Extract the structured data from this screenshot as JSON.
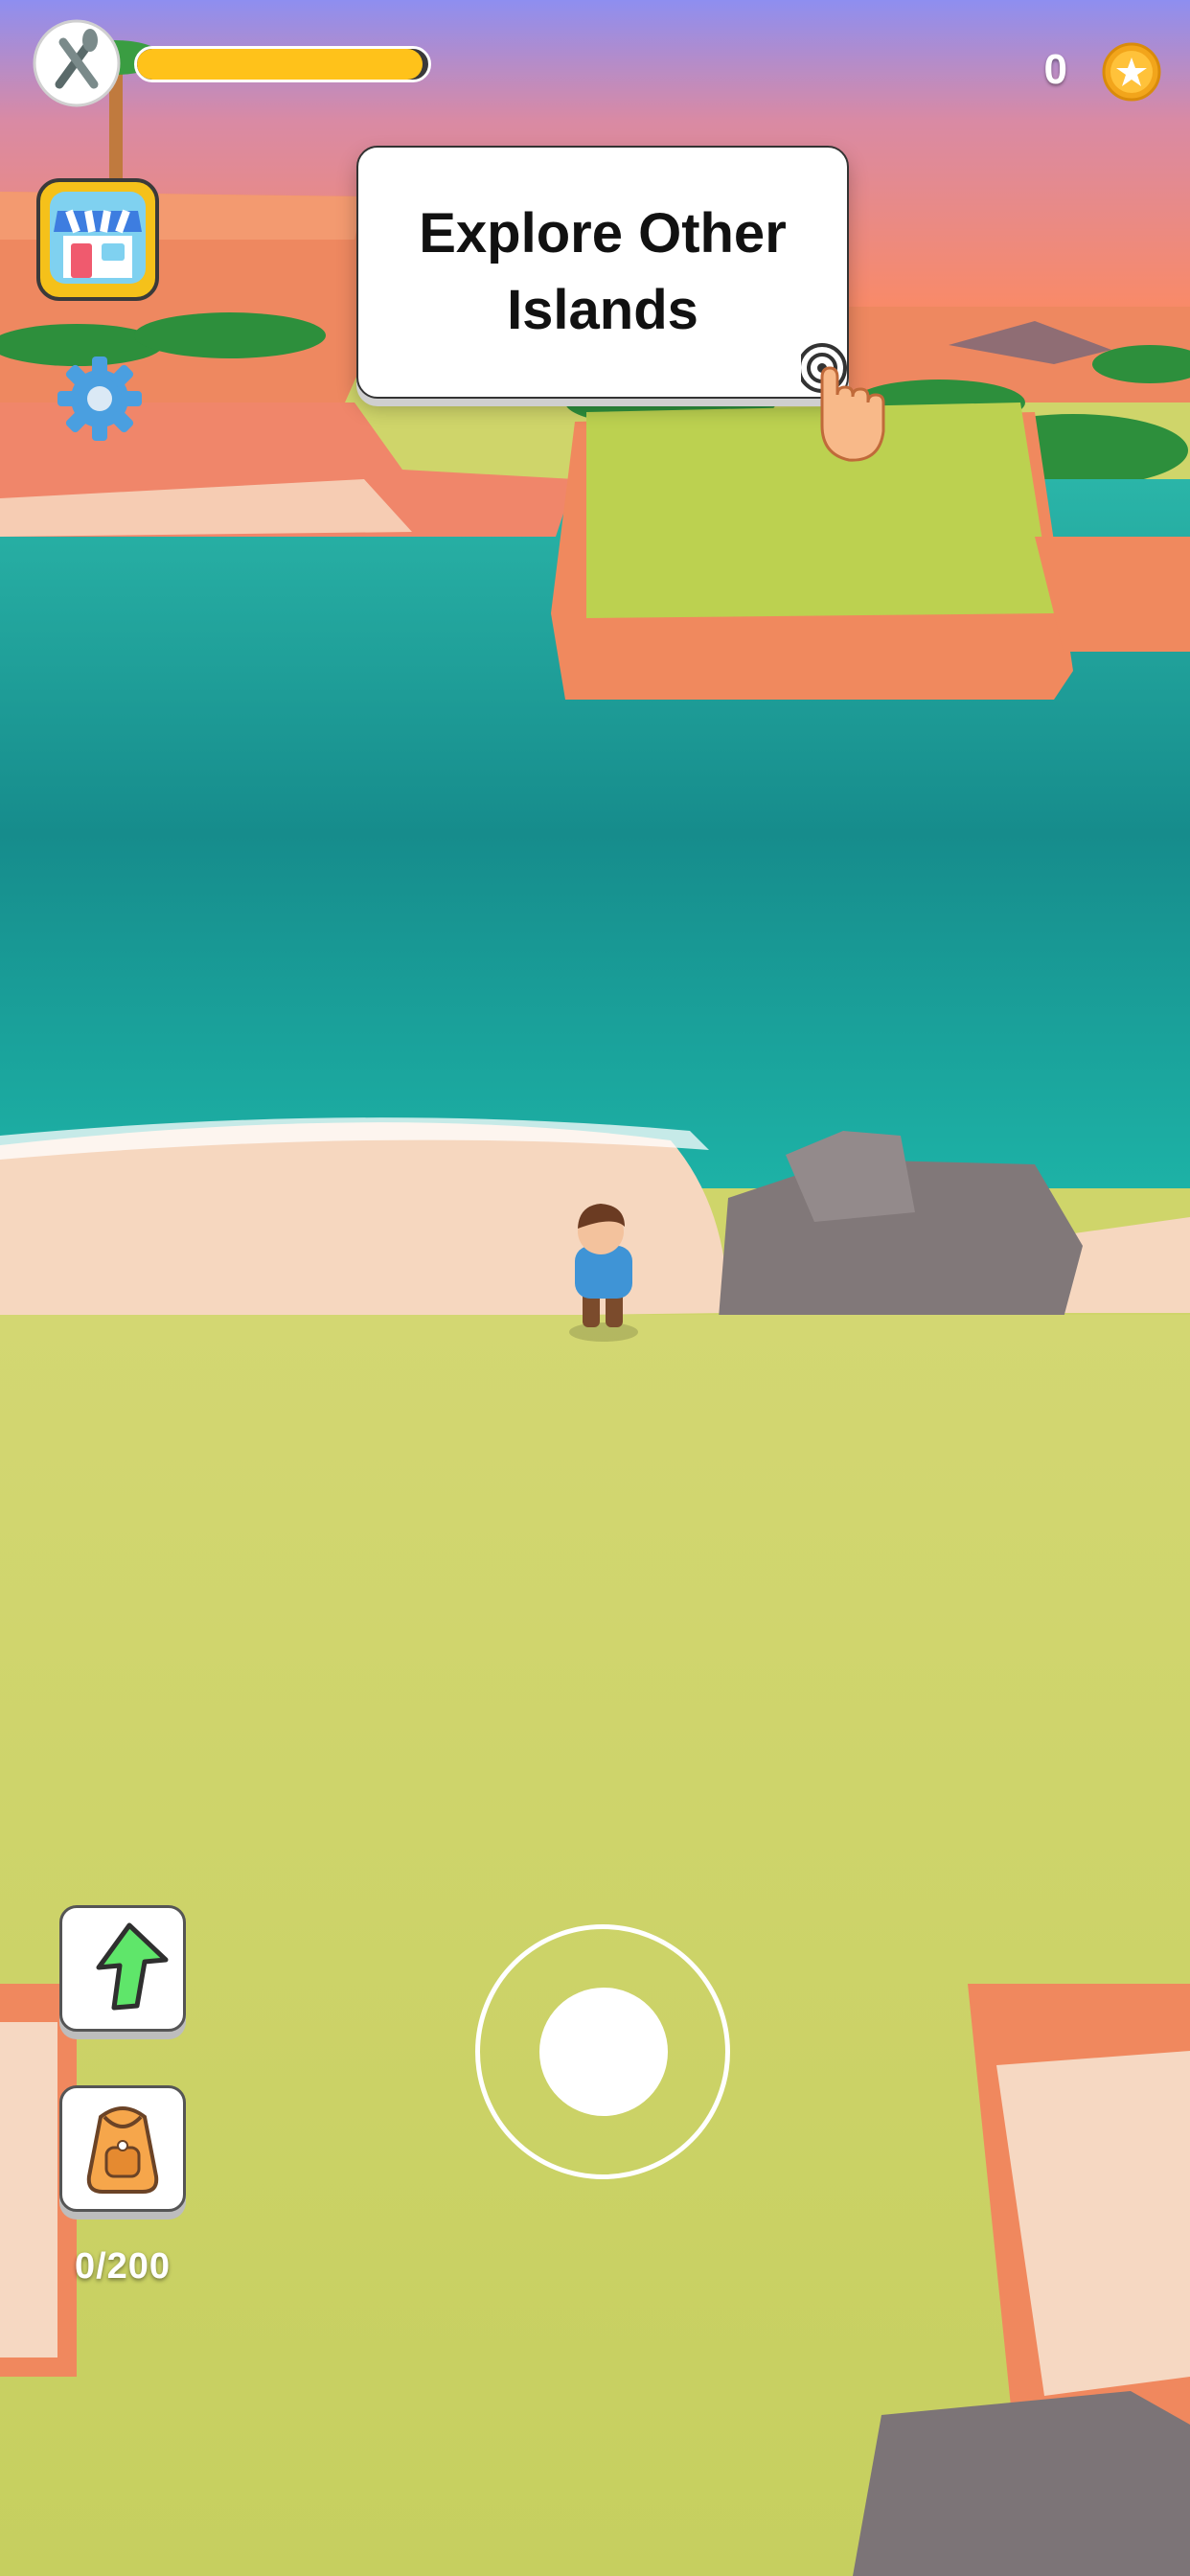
{
  "hud": {
    "hunger": {
      "icon": "fork-knife-icon",
      "level": 0.98,
      "fill_color": "#ffc21a"
    },
    "coins": {
      "count": "0",
      "icon": "coin-star-icon"
    },
    "shop_icon": "shop-icon",
    "settings_icon": "gear-icon"
  },
  "tooltip": {
    "text": "Explore Other Islands",
    "hand_icon": "tap-hand-icon"
  },
  "actions": {
    "upgrade_icon": "green-arrow-up-icon",
    "backpack_icon": "backpack-icon",
    "backpack_count": "0/200"
  },
  "colors": {
    "sky_top": "#8e8ef0",
    "sky_bottom": "#ff8a5c",
    "water": "#1aa99f",
    "grass": "#cfd56a",
    "sand": "#f6d9c0",
    "cliff": "#f08d62"
  }
}
